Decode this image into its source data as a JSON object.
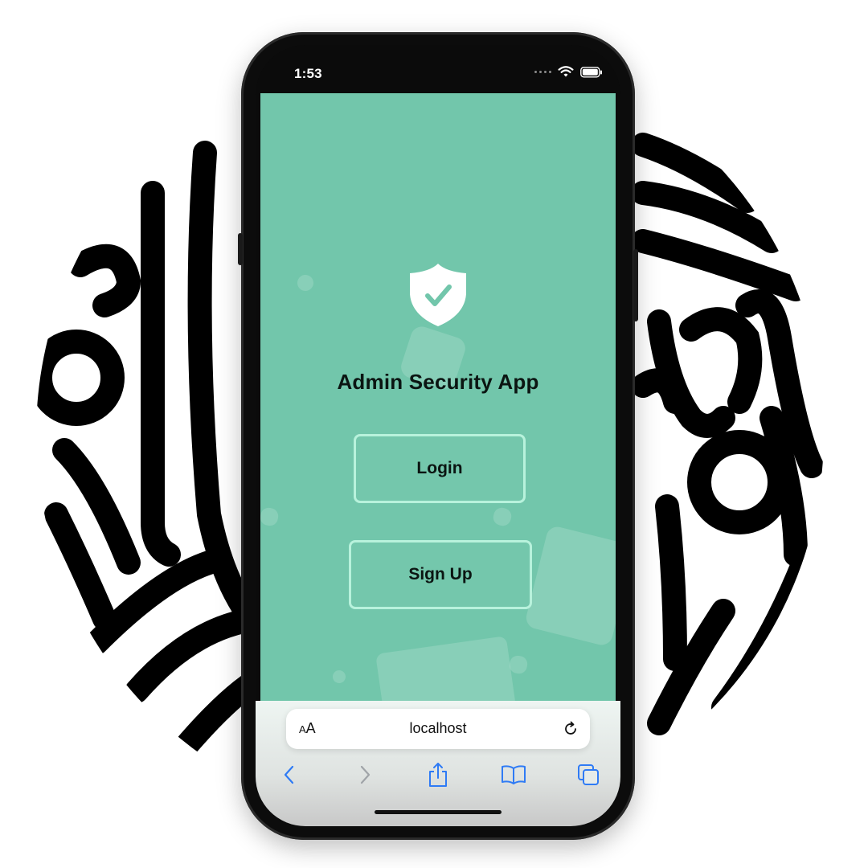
{
  "status_bar": {
    "time": "1:53",
    "signal_icon": "cellular-dots-icon",
    "wifi_icon": "wifi-icon",
    "battery_icon": "battery-icon"
  },
  "app": {
    "logo_icon": "shield-check-icon",
    "title": "Admin Security App",
    "login_label": "Login",
    "signup_label": "Sign Up",
    "background_color": "#72c6ab",
    "button_border_color": "#b8f2dc"
  },
  "browser": {
    "text_size_large": "A",
    "text_size_small": "A",
    "url": "localhost",
    "reload_icon": "reload-icon",
    "toolbar": {
      "back_icon": "chevron-left-icon",
      "forward_icon": "chevron-right-icon",
      "share_icon": "share-icon",
      "bookmarks_icon": "book-icon",
      "tabs_icon": "tabs-icon"
    },
    "accent_color": "#2f7bf5"
  }
}
